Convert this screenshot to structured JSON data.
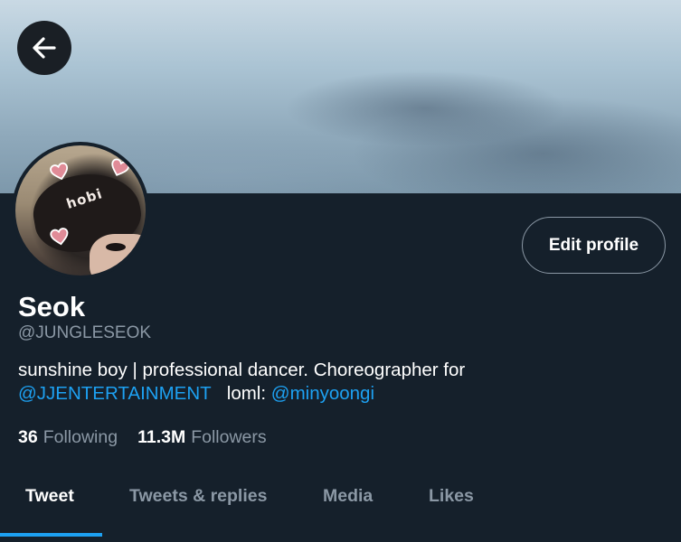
{
  "header": {
    "back_icon": "arrow-left-icon"
  },
  "profile": {
    "name": "Seok",
    "handle": "@JUNGLESEOK",
    "avatar_text": "hobi",
    "edit_button_label": "Edit profile",
    "bio": {
      "text": "sunshine boy | professional dancer. Choreographer for",
      "mention_1": "@JJENTERTAINMENT",
      "text_2": "loml:",
      "mention_2": "@minyoongi"
    },
    "stats": {
      "following_count": "36",
      "following_label": "Following",
      "followers_count": "11.3M",
      "followers_label": "Followers"
    }
  },
  "tabs": [
    {
      "label": "Tweet",
      "active": true
    },
    {
      "label": "Tweets & replies",
      "active": false
    },
    {
      "label": "Media",
      "active": false
    },
    {
      "label": "Likes",
      "active": false
    }
  ],
  "colors": {
    "background": "#15202b",
    "accent": "#1da1f2",
    "secondary_text": "#8b98a5"
  }
}
